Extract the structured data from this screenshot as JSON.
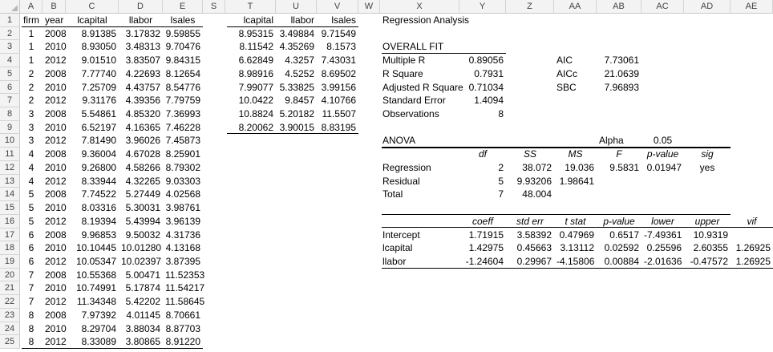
{
  "columns": [
    "A",
    "B",
    "C",
    "D",
    "E",
    "S",
    "T",
    "U",
    "V",
    "W",
    "X",
    "Y",
    "Z",
    "AA",
    "AB",
    "AC",
    "AD",
    "AE"
  ],
  "rows": [
    "1",
    "2",
    "3",
    "4",
    "5",
    "6",
    "7",
    "8",
    "9",
    "10",
    "11",
    "12",
    "13",
    "14",
    "15",
    "16",
    "17",
    "18",
    "19",
    "20",
    "21",
    "22",
    "23",
    "24",
    "25"
  ],
  "data_table": {
    "headers": [
      "firm",
      "year",
      "lcapital",
      "llabor",
      "lsales"
    ],
    "rows": [
      [
        "1",
        "2008",
        "8.91385",
        "3.17832",
        "9.59855"
      ],
      [
        "1",
        "2010",
        "8.93050",
        "3.48313",
        "9.70476"
      ],
      [
        "1",
        "2012",
        "9.01510",
        "3.83507",
        "9.84315"
      ],
      [
        "2",
        "2008",
        "7.77740",
        "4.22693",
        "8.12654"
      ],
      [
        "2",
        "2010",
        "7.25709",
        "4.43757",
        "8.54776"
      ],
      [
        "2",
        "2012",
        "9.31176",
        "4.39356",
        "7.79759"
      ],
      [
        "3",
        "2008",
        "5.54861",
        "4.85320",
        "7.36993"
      ],
      [
        "3",
        "2010",
        "6.52197",
        "4.16365",
        "7.46228"
      ],
      [
        "3",
        "2012",
        "7.81490",
        "3.96026",
        "7.45873"
      ],
      [
        "4",
        "2008",
        "9.36004",
        "4.67028",
        "8.25901"
      ],
      [
        "4",
        "2010",
        "9.26800",
        "4.58266",
        "8.79302"
      ],
      [
        "4",
        "2012",
        "8.33944",
        "4.32265",
        "9.03303"
      ],
      [
        "5",
        "2008",
        "7.74522",
        "5.27449",
        "4.02568"
      ],
      [
        "5",
        "2010",
        "8.03316",
        "5.30031",
        "3.98761"
      ],
      [
        "5",
        "2012",
        "8.19394",
        "5.43994",
        "3.96139"
      ],
      [
        "6",
        "2008",
        "9.96853",
        "9.50032",
        "4.31736"
      ],
      [
        "6",
        "2010",
        "10.10445",
        "10.01280",
        "4.13168"
      ],
      [
        "6",
        "2012",
        "10.05347",
        "10.02397",
        "3.87395"
      ],
      [
        "7",
        "2008",
        "10.55368",
        "5.00471",
        "11.52353"
      ],
      [
        "7",
        "2010",
        "10.74991",
        "5.17874",
        "11.54217"
      ],
      [
        "7",
        "2012",
        "11.34348",
        "5.42202",
        "11.58645"
      ],
      [
        "8",
        "2008",
        "7.97392",
        "4.01145",
        "8.70661"
      ],
      [
        "8",
        "2010",
        "8.29704",
        "3.88034",
        "8.87703"
      ],
      [
        "8",
        "2012",
        "8.33089",
        "3.80865",
        "8.91220"
      ]
    ]
  },
  "means_table": {
    "headers": [
      "lcapital",
      "llabor",
      "lsales"
    ],
    "rows": [
      [
        "8.95315",
        "3.49884",
        "9.71549"
      ],
      [
        "8.11542",
        "4.35269",
        "8.1573"
      ],
      [
        "6.62849",
        "4.3257",
        "7.43031"
      ],
      [
        "8.98916",
        "4.5252",
        "8.69502"
      ],
      [
        "7.99077",
        "5.33825",
        "3.99156"
      ],
      [
        "10.0422",
        "9.8457",
        "4.10766"
      ],
      [
        "10.8824",
        "5.20182",
        "11.5507"
      ],
      [
        "8.20062",
        "3.90015",
        "8.83195"
      ]
    ]
  },
  "regression": {
    "title": "Regression Analysis",
    "overall_fit_label": "OVERALL FIT",
    "fit_stats": [
      {
        "label": "Multiple R",
        "value": "0.89056"
      },
      {
        "label": "R Square",
        "value": "0.7931"
      },
      {
        "label": "Adjusted R Square",
        "value": "0.71034"
      },
      {
        "label": "Standard Error",
        "value": "1.4094"
      },
      {
        "label": "Observations",
        "value": "8"
      }
    ],
    "info_criteria": [
      {
        "label": "AIC",
        "value": "7.73061"
      },
      {
        "label": "AICc",
        "value": "21.0639"
      },
      {
        "label": "SBC",
        "value": "7.96893"
      }
    ],
    "anova": {
      "label": "ANOVA",
      "alpha_label": "Alpha",
      "alpha_value": "0.05",
      "headers": [
        "df",
        "SS",
        "MS",
        "F",
        "p-value",
        "sig"
      ],
      "rows": [
        {
          "label": "Regression",
          "cells": [
            "2",
            "38.072",
            "19.036",
            "9.5831",
            "0.01947",
            "yes"
          ]
        },
        {
          "label": "Residual",
          "cells": [
            "5",
            "9.93206",
            "1.98641",
            "",
            "",
            ""
          ]
        },
        {
          "label": "Total",
          "cells": [
            "7",
            "48.004",
            "",
            "",
            "",
            ""
          ]
        }
      ]
    },
    "coefficients": {
      "headers": [
        "coeff",
        "std err",
        "t stat",
        "p-value",
        "lower",
        "upper",
        "vif"
      ],
      "rows": [
        {
          "label": "Intercept",
          "cells": [
            "1.71915",
            "3.58392",
            "0.47969",
            "0.6517",
            "-7.49361",
            "10.9319",
            ""
          ]
        },
        {
          "label": "lcapital",
          "cells": [
            "1.42975",
            "0.45663",
            "3.13112",
            "0.02592",
            "0.25596",
            "2.60355",
            "1.26925"
          ]
        },
        {
          "label": "llabor",
          "cells": [
            "-1.24604",
            "0.29967",
            "-4.15806",
            "0.00884",
            "-2.01636",
            "-0.47572",
            "1.26925"
          ]
        }
      ]
    }
  }
}
